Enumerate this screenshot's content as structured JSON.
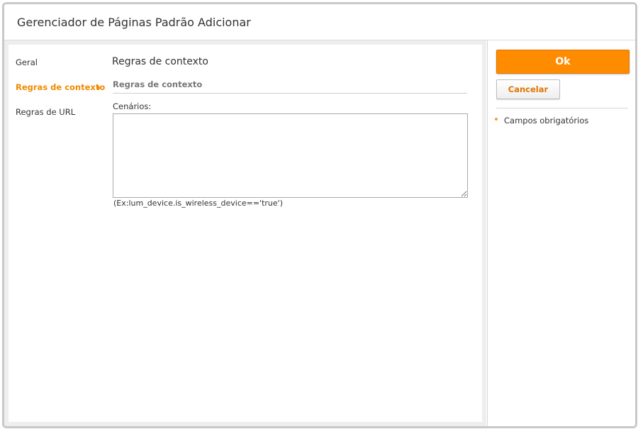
{
  "window": {
    "title": "Gerenciador de Páginas Padrão Adicionar"
  },
  "nav": {
    "items": [
      {
        "label": "Geral"
      },
      {
        "label": "Regras de contexto"
      },
      {
        "label": "Regras de URL"
      }
    ]
  },
  "content": {
    "section_heading": "Regras de contexto",
    "subsection_heading": "Regras de contexto",
    "scenarios_label": "Cenários:",
    "scenarios_value": "",
    "hint": "(Ex:lum_device.is_wireless_device=='true')"
  },
  "actions": {
    "ok_label": "Ok",
    "cancel_label": "Cancelar"
  },
  "side": {
    "required_fields_label": "Campos obrigatórios"
  },
  "colors": {
    "accent": "#ff8c00",
    "active_nav": "#f08a00"
  }
}
